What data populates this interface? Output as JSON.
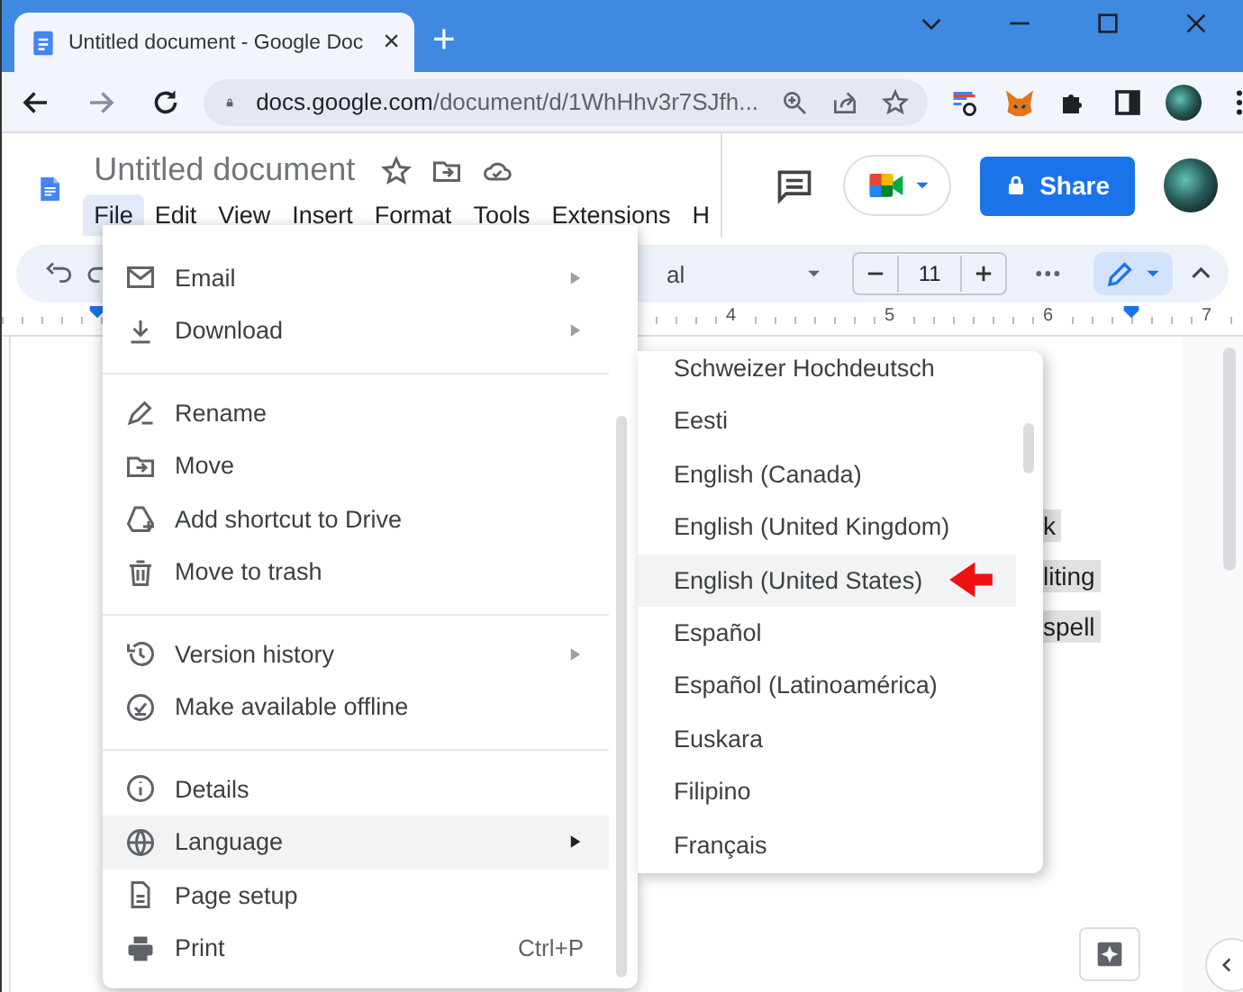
{
  "browser": {
    "tab": {
      "title": "Untitled document - Google Doc",
      "close": "×"
    },
    "new_tab": "+",
    "url": {
      "host": "docs.google.com",
      "path": "/document/d/1WhHhv3r7SJfh..."
    }
  },
  "docs": {
    "title": "Untitled document",
    "menus": [
      {
        "label": "File",
        "selected": true
      },
      {
        "label": "Edit",
        "selected": false
      },
      {
        "label": "View",
        "selected": false
      },
      {
        "label": "Insert",
        "selected": false
      },
      {
        "label": "Format",
        "selected": false
      },
      {
        "label": "Tools",
        "selected": false
      },
      {
        "label": "Extensions",
        "selected": false
      },
      {
        "label": "H",
        "selected": false
      }
    ],
    "share": "Share"
  },
  "toolbar": {
    "font": "al",
    "font_size": "11"
  },
  "ruler": [
    "4",
    "5",
    "6",
    "7"
  ],
  "document": {
    "fragments": [
      "k",
      "liting",
      "spell"
    ]
  },
  "file_menu": {
    "items": [
      {
        "kind": "item",
        "label": "Email",
        "submenu": true,
        "highlighted": false
      },
      {
        "kind": "item",
        "label": "Download",
        "submenu": true,
        "highlighted": false
      },
      {
        "kind": "divider"
      },
      {
        "kind": "item",
        "label": "Rename",
        "submenu": false,
        "highlighted": false
      },
      {
        "kind": "item",
        "label": "Move",
        "submenu": false,
        "highlighted": false
      },
      {
        "kind": "item",
        "label": "Add shortcut to Drive",
        "submenu": false,
        "highlighted": false
      },
      {
        "kind": "item",
        "label": "Move to trash",
        "submenu": false,
        "highlighted": false
      },
      {
        "kind": "divider"
      },
      {
        "kind": "item",
        "label": "Version history",
        "submenu": true,
        "highlighted": false
      },
      {
        "kind": "item",
        "label": "Make available offline",
        "submenu": false,
        "highlighted": false
      },
      {
        "kind": "divider"
      },
      {
        "kind": "item",
        "label": "Details",
        "submenu": false,
        "highlighted": false
      },
      {
        "kind": "item",
        "label": "Language",
        "submenu": true,
        "highlighted": true
      },
      {
        "kind": "item",
        "label": "Page setup",
        "submenu": false,
        "highlighted": false
      },
      {
        "kind": "item",
        "label": "Print",
        "submenu": false,
        "highlighted": false,
        "shortcut": "Ctrl+P"
      }
    ]
  },
  "language_menu": {
    "items": [
      {
        "label": "Schweizer Hochdeutsch",
        "selected": false
      },
      {
        "label": "Eesti",
        "selected": false
      },
      {
        "label": "English (Canada)",
        "selected": false
      },
      {
        "label": "English (United Kingdom)",
        "selected": false
      },
      {
        "label": "English (United States)",
        "selected": true
      },
      {
        "label": "Español",
        "selected": false
      },
      {
        "label": "Español (Latinoamérica)",
        "selected": false
      },
      {
        "label": "Euskara",
        "selected": false
      },
      {
        "label": "Filipino",
        "selected": false
      },
      {
        "label": "Français",
        "selected": false
      }
    ]
  }
}
